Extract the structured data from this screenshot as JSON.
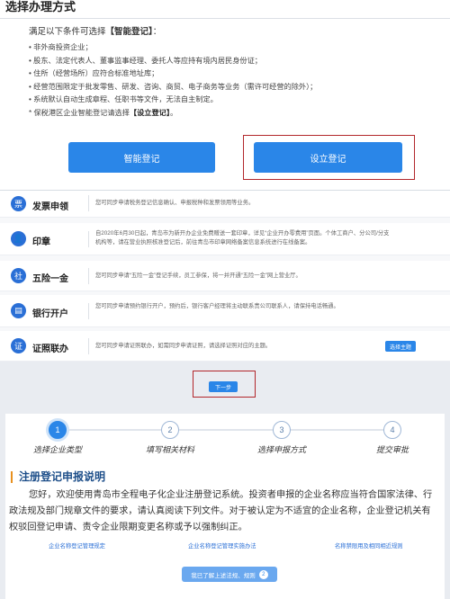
{
  "modal": {
    "title": "选择办理方式",
    "intro_prefix": "满足以下条件可选择",
    "intro_highlight": "【智能登记】",
    "intro_suffix": "：",
    "conditions": [
      "• 非外商投资企业；",
      "• 股东、法定代表人、董事监事经理、委托人等应持有境内居民身份证；",
      "• 住所（经营场所）应符合标准地址库；",
      "• 经营范围限定于批发零售、研发、咨询、商贸、电子商务等业务（需许可经营的除外）；",
      "• 系统默认自动生成章程、任职书等文件，无法自主制定。"
    ],
    "note_prefix": "* 保税港区企业智能登记请选择",
    "note_highlight": "【设立登记】",
    "note_suffix": "。",
    "smart_button": "智能登记",
    "setup_button": "设立登记"
  },
  "services": [
    {
      "icon": "invoice-icon",
      "icon_glyph": "票",
      "name": "发票申领",
      "desc": "您可同步申请税务登记信息确认、申报税种和发票领用等业务。"
    },
    {
      "icon": "seal-icon",
      "icon_glyph": "👤",
      "name": "印章",
      "desc": "自2020年6月30日起，青岛市为新开办企业免费赠送一套印章，详见“企业开办零费用”页面。个体工商户、分公司/分支机构等，请在营业执照核准登记后，前往青岛市印章网络备案信息系统进行在线备案。"
    },
    {
      "icon": "insurance-icon",
      "icon_glyph": "社",
      "name": "五险一金",
      "desc": "您可同步申请“五险一金”登记手续，员工参保，将一并开通“五险一金”网上营业厅。"
    },
    {
      "icon": "bank-icon",
      "icon_glyph": "▤",
      "name": "银行开户",
      "desc": "您可同步申请预约银行开户，预约后，银行客户经理将主动联系贵公司联系人，请保持电话畅通。"
    },
    {
      "icon": "license-icon",
      "icon_glyph": "证",
      "name": "证照联办",
      "desc": "您可同步申请证照联办，如需同步申请证照，请选择证照对应的主题。",
      "button": "选择主题"
    }
  ],
  "next_button": "下一步",
  "steps": [
    {
      "num": "1",
      "label": "选择企业类型"
    },
    {
      "num": "2",
      "label": "填写相关材料"
    },
    {
      "num": "3",
      "label": "选择申报方式"
    },
    {
      "num": "4",
      "label": "提交审批"
    }
  ],
  "notice": {
    "title": "注册登记申报说明",
    "text": "您好，欢迎使用青岛市全程电子化企业注册登记系统。投资者申报的企业名称应当符合国家法律、行政法规及部门规章文件的要求，请认真阅读下列文件。对于被认定为不适宜的企业名称，企业登记机关有权驳回登记申请、责令企业限期变更名称或予以强制纠正。",
    "rules": [
      "企业名称登记管理规定",
      "企业名称登记管理实施办法",
      "名称禁限用及相同相近规则"
    ],
    "ack_button": "我已了解上述法规、规则",
    "ack_count": "2"
  }
}
